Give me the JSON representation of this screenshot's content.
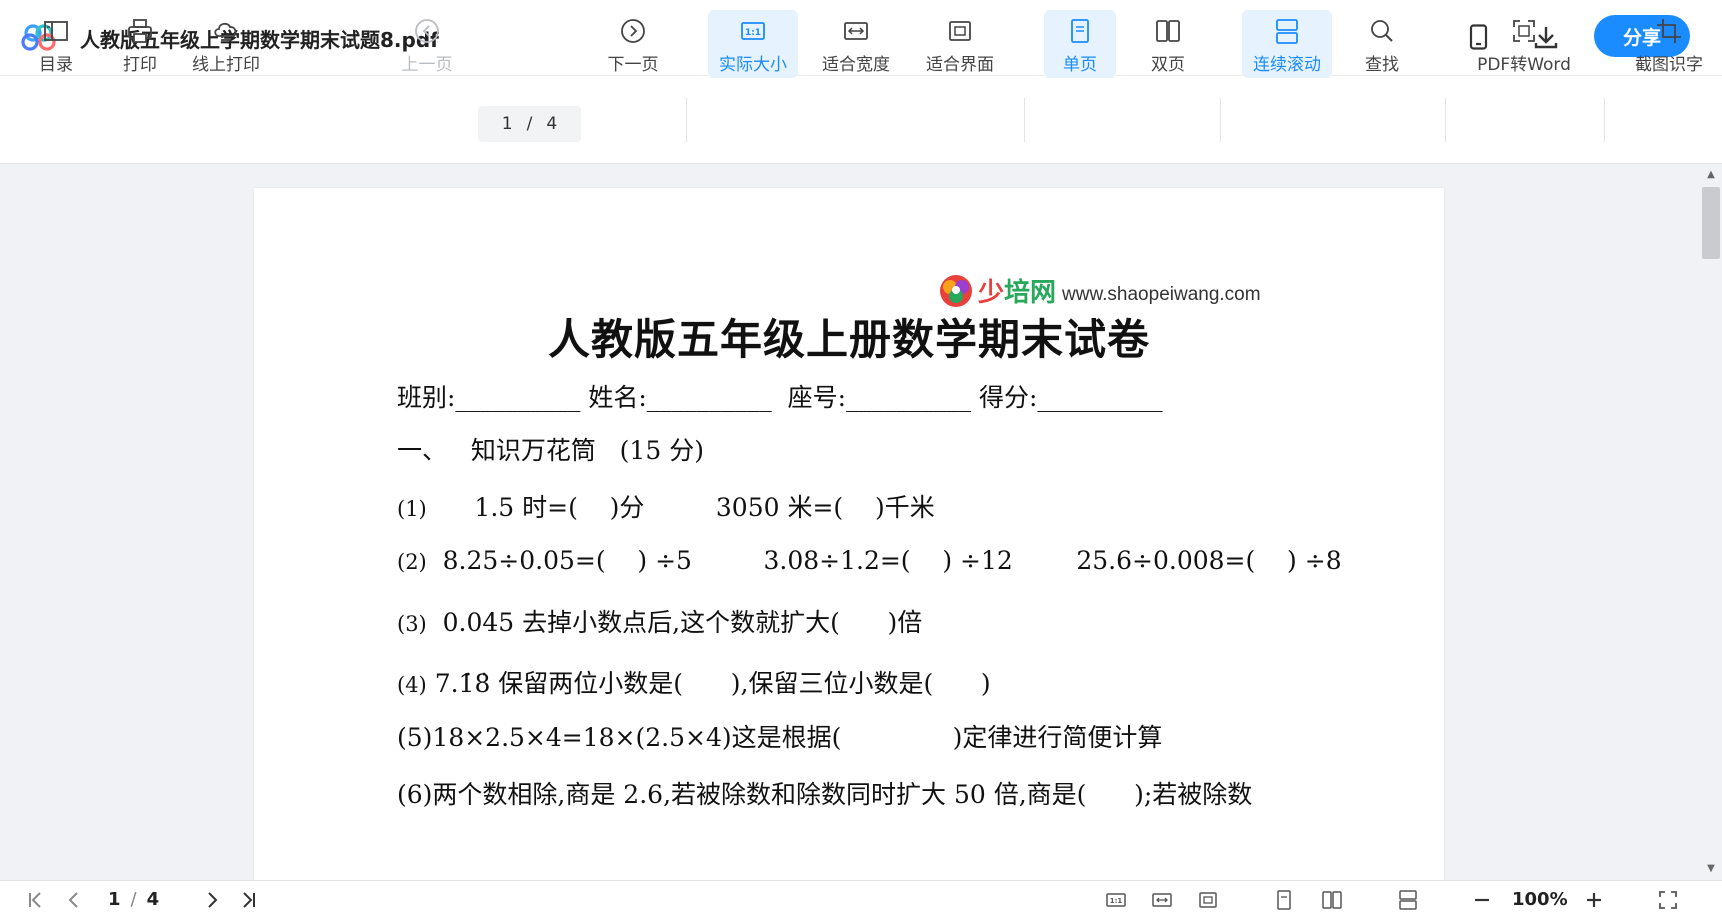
{
  "app": {
    "doc_title": "人教版五年级上学期数学期末试题8.pdf",
    "share_label": "分享",
    "accent": "#1a8cff"
  },
  "toolbar": {
    "toc": "目录",
    "print": "打印",
    "online_print": "线上打印",
    "prev_page": "上一页",
    "current_page": "1",
    "total_pages": "4",
    "page_sep": "/",
    "next_page": "下一页",
    "actual_size": "实际大小",
    "fit_width": "适合宽度",
    "fit_screen": "适合界面",
    "single_page": "单页",
    "double_page": "双页",
    "continuous_scroll": "连续滚动",
    "find": "查找",
    "pdf_to_word": "PDF转Word",
    "screenshot_ocr": "截图识字"
  },
  "document": {
    "watermark_name_a": "少",
    "watermark_name_b": "培网",
    "watermark_url": "www.shaopeiwang.com",
    "title": "人教版五年级上册数学期末试卷",
    "info_line": "班别:__________ 姓名:__________  座号:__________ 得分:__________",
    "section1": "一、   知识万花筒   (15 分)",
    "q1_num": "(1)",
    "q1": "      1.5 时=(    )分         3050 米=(    )千米",
    "q2_num": "(2)",
    "q2": "  8.25÷0.05=(    ) ÷5         3.08÷1.2=(    ) ÷12        25.6÷0.008=(    ) ÷8",
    "q3_num": "(3)",
    "q3": "  0.045 去掉小数点后,这个数就扩大(      )倍",
    "q4_num": "(4)",
    "q4": " 7.1̇8̇ 保留两位小数是(      ),保留三位小数是(      )",
    "q5": "(5)18×2.5×4=18×(2.5×4)这是根据(              )定律进行简便计算",
    "q6": "(6)两个数相除,商是 2.6,若被除数和除数同时扩大 50 倍,商是(      );若被除数"
  },
  "statusbar": {
    "current_page": "1",
    "page_sep": "/",
    "total_pages": "4",
    "zoom": "100%"
  }
}
